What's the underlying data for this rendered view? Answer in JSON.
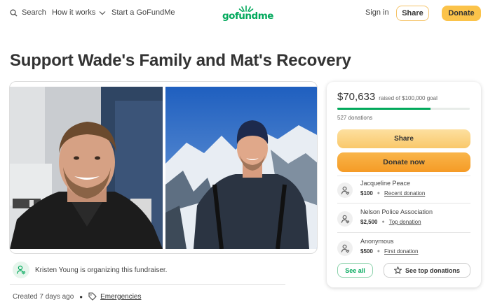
{
  "header": {
    "search_label": "Search",
    "how_it_works_label": "How it works",
    "start_label": "Start a GoFundMe",
    "logo_text": "gofundme",
    "signin_label": "Sign in",
    "share_label": "Share",
    "donate_label": "Donate"
  },
  "campaign": {
    "title": "Support Wade's Family and Mat's Recovery",
    "organizer_text": "Kristen Young is organizing this fundraiser.",
    "created": "Created 7 days ago",
    "category": "Emergencies"
  },
  "donation_card": {
    "raised_amount": "$70,633",
    "goal_text": "raised of $100,000 goal",
    "progress_fraction": 0.706,
    "donations_count": "527 donations",
    "share_label": "Share",
    "donate_now_label": "Donate now",
    "donors": [
      {
        "name": "Jacqueline Peace",
        "amount": "$100",
        "tag": "Recent donation"
      },
      {
        "name": "Nelson Police Association",
        "amount": "$2,500",
        "tag": "Top donation"
      },
      {
        "name": "Anonymous",
        "amount": "$500",
        "tag": "First donation"
      }
    ],
    "see_all_label": "See all",
    "see_top_label": "See top donations"
  },
  "colors": {
    "brand_green": "#02a95c",
    "donate_orange": "#f59b26",
    "share_yellow": "#fbc34a"
  }
}
